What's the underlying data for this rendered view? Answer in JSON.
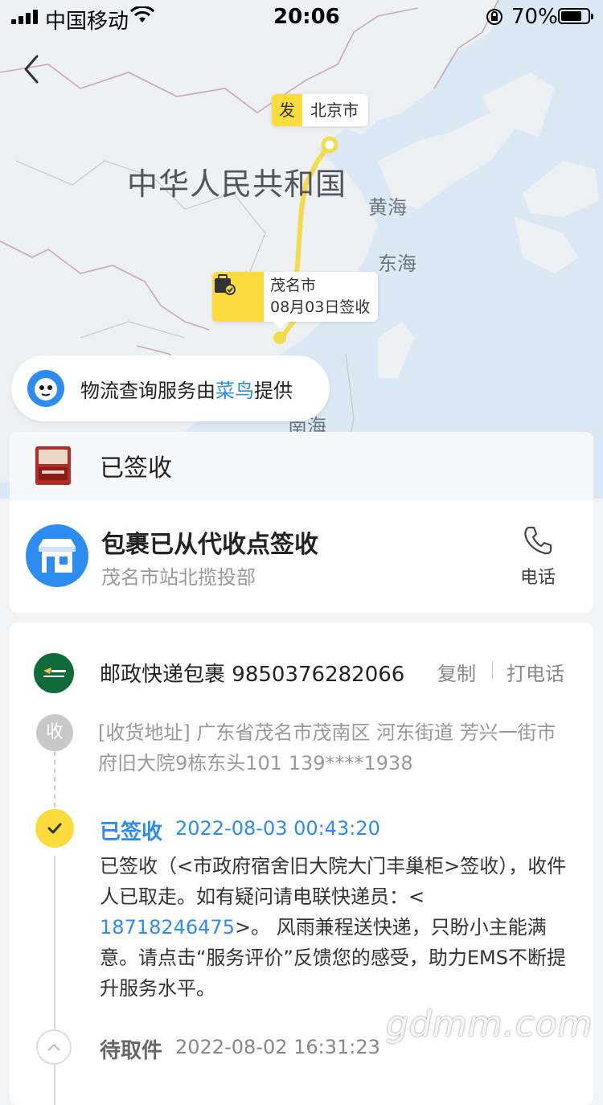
{
  "status_bar": {
    "carrier": "中国移动",
    "time": "20:06",
    "battery": "70%"
  },
  "map": {
    "country_label": "中华人民共和国",
    "seas": [
      "黄海",
      "东海",
      "南海"
    ],
    "from": {
      "tag": "发",
      "city": "北京市"
    },
    "to": {
      "city": "茂名市",
      "event": "08月03日签收"
    }
  },
  "provider": {
    "prefix": "物流查询服务由",
    "name": "菜鸟",
    "suffix": "提供"
  },
  "status_card": {
    "title": "已签收"
  },
  "pickup": {
    "title": "包裹已从代收点签收",
    "subtitle": "茂名市站北揽投部",
    "phone_label": "电话"
  },
  "tracking": {
    "courier": "邮政快递包裹",
    "number": "9850376282066",
    "copy_label": "复制",
    "call_label": "打电话",
    "receiver_node": "收",
    "address": "[收货地址] 广东省茂名市茂南区 河东街道 芳兴一街市府旧大院9栋东头101 139****1938",
    "events": [
      {
        "title": "已签收",
        "time": "2022-08-03 00:43:20",
        "desc_a": "已签收（<市政府宿舍旧大院大门丰巢柜>签收），收件人已取走。如有疑问请电联快递员：< ",
        "phone": "18718246475",
        "desc_b": ">。 风雨兼程送快递，只盼小主能满意。请点击“服务评价”反馈您的感受，助力EMS不断提升服务水平。"
      },
      {
        "title": "待取件",
        "time": "2022-08-02 16:31:23"
      }
    ]
  },
  "watermark": "gdmm.com",
  "colors": {
    "accent": "#fbdc3c",
    "link": "#2d8cf0",
    "map_water": "#dbe9f6",
    "land": "#eef1f4"
  }
}
